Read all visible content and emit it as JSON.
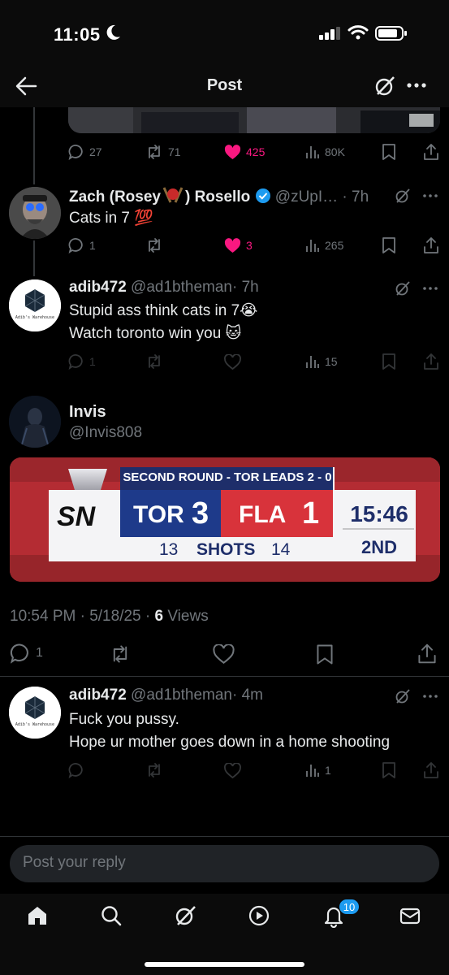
{
  "status_bar": {
    "time": "11:05"
  },
  "header": {
    "title": "Post"
  },
  "top_tweet_actions": {
    "replies": "27",
    "reposts": "71",
    "likes": "425",
    "views": "80K"
  },
  "tweets": [
    {
      "name": "Zach (Rosey",
      "name_suffix": ") Rosello",
      "handle": "@zUpI…",
      "time": "· 7h",
      "body_lines": [
        "Cats in 7 💯"
      ],
      "replies": "1",
      "reposts": "",
      "likes": "3",
      "views": "265"
    },
    {
      "name": "adib472",
      "handle": "@ad1btheman",
      "time": "· 7h",
      "avatar_text": "Adib's Warehouse",
      "body_lines": [
        "Stupid ass think cats in 7😭",
        "Watch toronto win you 🐱"
      ],
      "replies": "1",
      "reposts": "",
      "likes": "",
      "views": "15"
    }
  ],
  "main_post": {
    "name": "Invis",
    "handle": "@Invis808",
    "scorebug": {
      "banner": "SECOND ROUND - TOR LEADS 2 - 0",
      "network": "SN",
      "team1": "TOR",
      "score1": "3",
      "team2": "FLA",
      "score2": "1",
      "clock": "15:46",
      "period": "2ND",
      "shots1": "13",
      "shots_label": "SHOTS",
      "shots2": "14"
    },
    "time": "10:54 PM · 5/18/25 · ",
    "views_count": "6",
    "views_label": " Views",
    "replies": "1"
  },
  "reply_tweet": {
    "name": "adib472",
    "handle": "@ad1btheman",
    "time": "· 4m",
    "avatar_text": "Adib's Warehouse",
    "body_lines": [
      "Fuck you pussy.",
      "Hope ur mother goes down in a home shooting"
    ],
    "views": "1"
  },
  "reply_box": {
    "placeholder": "Post your reply"
  },
  "tab_bar": {
    "notifications_badge": "10"
  },
  "colors": {
    "like": "#f91880",
    "verified": "#1d9bf0",
    "accent": "#1d9bf0"
  }
}
